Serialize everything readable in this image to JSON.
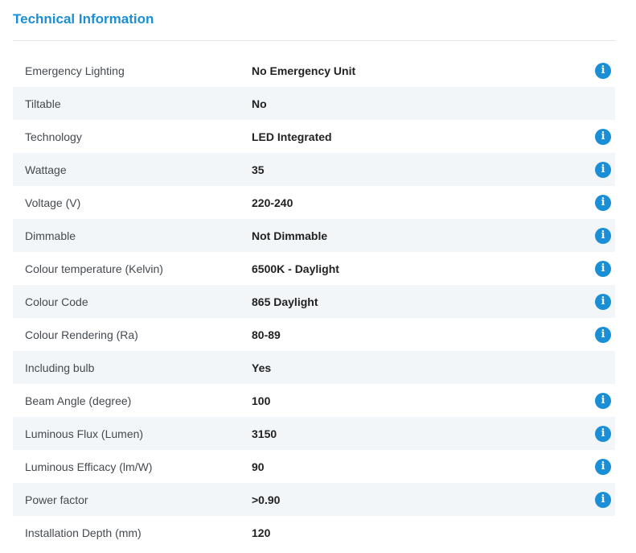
{
  "section": {
    "title": "Technical Information"
  },
  "icons": {
    "info": "info-icon",
    "info_glyph": "i"
  },
  "colors": {
    "accent": "#1a8fd6",
    "row_shade": "#f3f6f8"
  },
  "specs": [
    {
      "label": "Emergency Lighting",
      "value": "No Emergency Unit",
      "info": true
    },
    {
      "label": "Tiltable",
      "value": "No",
      "info": false
    },
    {
      "label": "Technology",
      "value": "LED Integrated",
      "info": true
    },
    {
      "label": "Wattage",
      "value": "35",
      "info": true
    },
    {
      "label": "Voltage (V)",
      "value": "220-240",
      "info": true
    },
    {
      "label": "Dimmable",
      "value": "Not Dimmable",
      "info": true
    },
    {
      "label": "Colour temperature (Kelvin)",
      "value": "6500K - Daylight",
      "info": true
    },
    {
      "label": "Colour Code",
      "value": "865 Daylight",
      "info": true
    },
    {
      "label": "Colour Rendering (Ra)",
      "value": "80-89",
      "info": true
    },
    {
      "label": "Including bulb",
      "value": "Yes",
      "info": false
    },
    {
      "label": "Beam Angle (degree)",
      "value": "100",
      "info": true
    },
    {
      "label": "Luminous Flux (Lumen)",
      "value": "3150",
      "info": true
    },
    {
      "label": "Luminous Efficacy (lm/W)",
      "value": "90",
      "info": true
    },
    {
      "label": "Power factor",
      "value": ">0.90",
      "info": true
    },
    {
      "label": "Installation Depth (mm)",
      "value": "120",
      "info": false
    }
  ]
}
